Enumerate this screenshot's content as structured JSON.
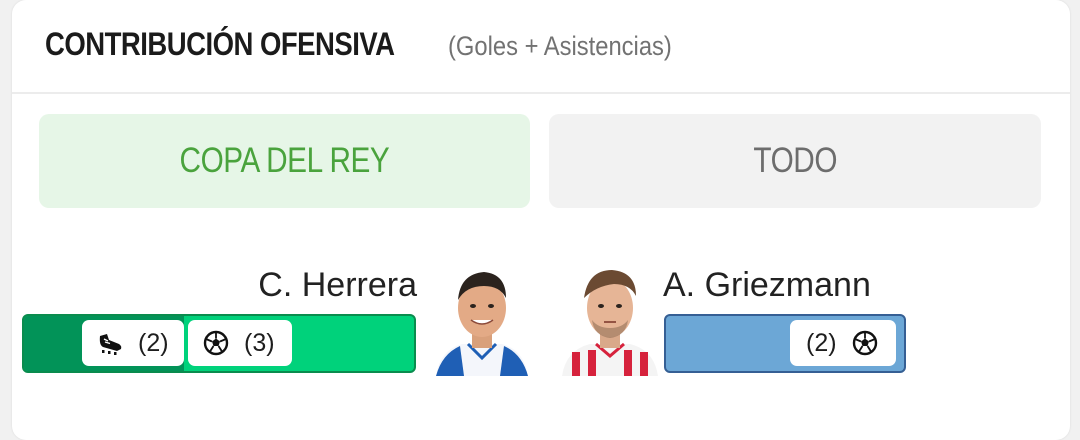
{
  "header": {
    "title": "CONTRIBUCIÓN OFENSIVA",
    "subtitle": "(Goles + Asistencias)"
  },
  "tabs": [
    {
      "label": "COPA DEL REY",
      "active": true
    },
    {
      "label": "TODO",
      "active": false
    }
  ],
  "players": {
    "left": {
      "name": "C. Herrera",
      "assists": "(2)",
      "goals": "(3)",
      "bar_colors": {
        "assists": "#029358",
        "goals": "#00d27b"
      }
    },
    "right": {
      "name": "A. Griezmann",
      "goals": "(2)",
      "bar_color": "#6ca7d6"
    }
  },
  "icons": {
    "assist": "boot-icon",
    "goal": "soccer-ball-icon"
  },
  "colors": {
    "accent_green": "#4aa33d",
    "tab_active_bg": "#e6f6e7",
    "tab_inactive_bg": "#f2f2f2"
  }
}
